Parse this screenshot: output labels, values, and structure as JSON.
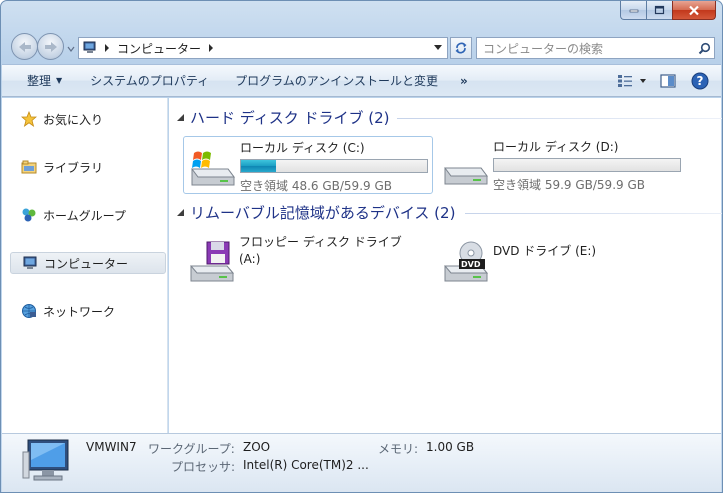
{
  "window": {
    "caption_buttons": [
      "minimize",
      "maximize",
      "close"
    ]
  },
  "address_bar": {
    "path": "コンピューター",
    "search_placeholder": "コンピューターの検索"
  },
  "command_bar": {
    "organize": "整理",
    "system_properties": "システムのプロパティ",
    "uninstall": "プログラムのアンインストールと変更",
    "more": "»"
  },
  "nav_pane": {
    "items": [
      {
        "label": "お気に入り",
        "icon": "star-icon"
      },
      {
        "label": "ライブラリ",
        "icon": "library-icon"
      },
      {
        "label": "ホームグループ",
        "icon": "homegroup-icon"
      },
      {
        "label": "コンピューター",
        "icon": "computer-icon",
        "selected": true
      },
      {
        "label": "ネットワーク",
        "icon": "network-icon"
      }
    ]
  },
  "groups": {
    "hard_disks": {
      "title": "ハード ディスク ドライブ (2)",
      "drives": [
        {
          "name": "ローカル ディスク (C:)",
          "free": "空き領域 48.6 GB/59.9 GB",
          "used_fraction": 0.19,
          "selected": true
        },
        {
          "name": "ローカル ディスク (D:)",
          "free": "空き領域 59.9 GB/59.9 GB",
          "used_fraction": 0.0
        }
      ]
    },
    "removable": {
      "title": "リムーバブル記憶域があるデバイス (2)",
      "devices": [
        {
          "name_line1": "フロッピー ディスク ドライブ",
          "name_line2": "(A:)"
        },
        {
          "name_line1": "DVD ドライブ (E:)",
          "name_line2": "",
          "badge": "DVD"
        }
      ]
    }
  },
  "details": {
    "computer_name": "VMWIN7",
    "workgroup_label": "ワークグループ:",
    "workgroup_value": "ZOO",
    "memory_label": "メモリ:",
    "memory_value": "1.00 GB",
    "processor_label": "プロセッサ:",
    "processor_value": "Intel(R) Core(TM)2 ..."
  },
  "colors": {
    "accent_blue": "#1e3287",
    "drive_bar": "#1b9fc4",
    "frame": "#b9d1ea"
  }
}
